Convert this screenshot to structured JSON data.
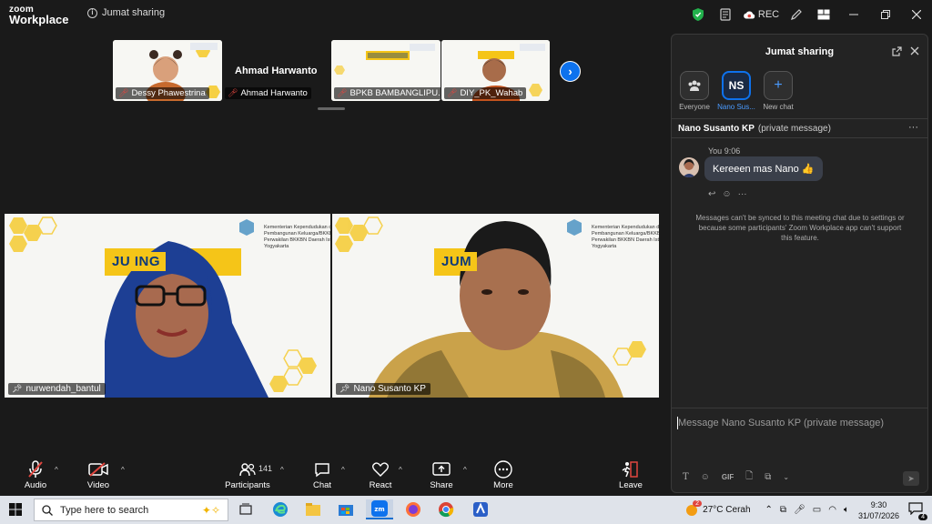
{
  "app": {
    "logo_line1": "zoom",
    "logo_line2": "Workplace",
    "meeting_title": "Jumat sharing"
  },
  "topbar": {
    "rec_label": "REC"
  },
  "thumbnails": [
    {
      "name": "Dessy Phawestrina"
    },
    {
      "name": "Ahmad Harwanto",
      "card_name": "Ahmad Harwanto"
    },
    {
      "name": "BPKB BAMBANGLIPU..."
    },
    {
      "name": "DIY_PK_Wahab"
    }
  ],
  "tiles": [
    {
      "name": "nurwendah_bantul",
      "banner": "JU      ING",
      "org": "Kementerian Kependudukan dan Pembangunan Keluarga/BKKBN Perwakilan BKKBN Daerah Istimewa Yogyakarta"
    },
    {
      "name": "Nano Susanto KP",
      "banner": "JUM",
      "org": "Kementerian Kependudukan dan Pembangunan Keluarga/BKKBN Perwakilan BKKBN Daerah Istimewa Yogyakarta"
    }
  ],
  "toolbar": {
    "audio": "Audio",
    "video": "Video",
    "participants": "Participants",
    "participants_count": "141",
    "chat": "Chat",
    "react": "React",
    "share": "Share",
    "more": "More",
    "leave": "Leave"
  },
  "chat_panel": {
    "title": "Jumat sharing",
    "recipients": [
      {
        "label": "Everyone",
        "initials": ""
      },
      {
        "label": "Nano Sus...",
        "initials": "NS"
      },
      {
        "label": "New chat",
        "initials": "+"
      }
    ],
    "pm_name": "Nano Susanto KP",
    "pm_suffix": "(private message)",
    "message": {
      "sender": "You",
      "time": "9:06",
      "text": "Kereeen mas Nano 👍"
    },
    "notice": "Messages can't be synced to this meeting chat due to settings or because some participants' Zoom Workplace app can't support this feature.",
    "compose_placeholder": "Message Nano Susanto KP (private message)"
  },
  "taskbar": {
    "search_placeholder": "Type here to search",
    "weather": "27°C  Cerah",
    "weather_badge": "2",
    "time": "9:30",
    "date": "31/07/2026",
    "notif_count": "4"
  },
  "colors": {
    "accent": "#0e72ed",
    "leave": "#e0463f",
    "banner_yellow": "#f5c518"
  }
}
